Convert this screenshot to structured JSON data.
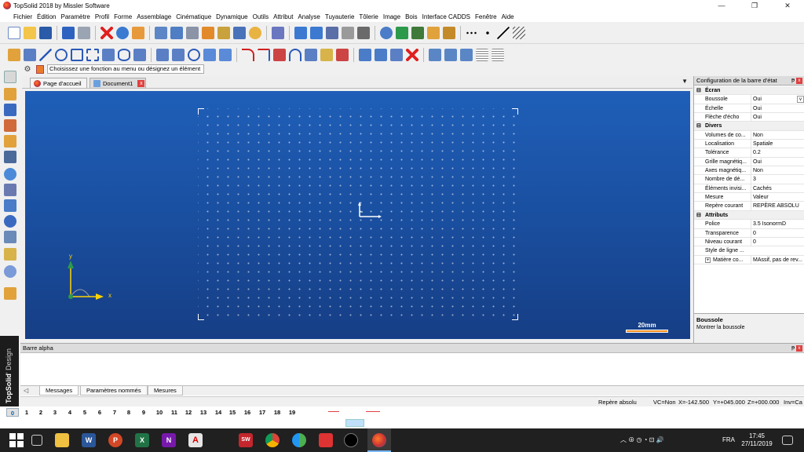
{
  "window": {
    "title": "TopSolid 2018 by Missler Software",
    "minimize_glyph": "—",
    "maximize_glyph": "❐",
    "close_glyph": "✕"
  },
  "menu": [
    "Fichier",
    "Édition",
    "Paramètre",
    "Profil",
    "Forme",
    "Assemblage",
    "Cinématique",
    "Dynamique",
    "Outils",
    "Attribut",
    "Analyse",
    "Tuyauterie",
    "Tôlerie",
    "Image",
    "Bois",
    "Interface CADDS",
    "Fenêtre",
    "Aide"
  ],
  "command_line": {
    "prompt": "Choisissez une fonction au menu ou désignez un élément"
  },
  "document_tabs": [
    {
      "label": "Page d'accueil",
      "active": false
    },
    {
      "label": "Document1",
      "active": true,
      "close_glyph": "x"
    }
  ],
  "tabs_dropdown_glyph": "▼",
  "viewport": {
    "axis_x_label": "x",
    "axis_y_label": "y",
    "scale_label": "20mm",
    "axis_color": "#ffd400",
    "background_top": "#1f5fb8",
    "background_bottom": "#163e85"
  },
  "right_panel": {
    "title": "Configuration de la barre d'état",
    "pin_glyph": "ᵽ",
    "close_glyph": "x",
    "expander_glyph": "⊟",
    "categories": [
      {
        "name": "Écran",
        "rows": [
          {
            "name": "Boussole",
            "value": "Oui",
            "selected": true
          },
          {
            "name": "Échelle",
            "value": "Oui"
          },
          {
            "name": "Flèche d'écho",
            "value": "Oui"
          }
        ]
      },
      {
        "name": "Divers",
        "rows": [
          {
            "name": "Volumes de co...",
            "value": "Non"
          },
          {
            "name": "Localisation",
            "value": "Spatiale"
          },
          {
            "name": "Tolérance",
            "value": "0.2"
          },
          {
            "name": "Grille magnétiq...",
            "value": "Oui"
          },
          {
            "name": "Axes magnétiq...",
            "value": "Non"
          },
          {
            "name": "Nombre de dé...",
            "value": "3"
          },
          {
            "name": "Éléments invisi...",
            "value": "Cachés"
          },
          {
            "name": "Mesure",
            "value": "Valeur"
          },
          {
            "name": "Repère courant",
            "value": "REPÈRE ABSOLU"
          }
        ]
      },
      {
        "name": "Attributs",
        "rows": [
          {
            "name": "Police",
            "value": "3.5  IsonormD"
          },
          {
            "name": "Transparence",
            "value": "0"
          },
          {
            "name": "Niveau courant",
            "value": "0"
          },
          {
            "name": "Style de ligne ...",
            "value": ""
          },
          {
            "name": "Matière co...",
            "value": "MAssif, pas de rev...",
            "plus": true
          }
        ]
      }
    ],
    "combo_glyph": "v",
    "plus_glyph": "+",
    "description_title": "Boussole",
    "description_text": "Montrer la boussole"
  },
  "bottom_pane": {
    "title": "Barre alpha",
    "pin_glyph": "ᵽ",
    "close_glyph": "x",
    "left_glyph": "◁",
    "tabs": [
      "Messages",
      "Paramètres nommés",
      "Mesures"
    ]
  },
  "status_bar": {
    "frame": "Repère absolu",
    "vc": "VC=Non",
    "x": "X=-142.500",
    "y": "Y=+045.000",
    "z": "Z=+000.000",
    "inv": "Inv=Ca"
  },
  "layers": [
    "0",
    "1",
    "2",
    "3",
    "4",
    "5",
    "6",
    "7",
    "8",
    "9",
    "10",
    "11",
    "12",
    "13",
    "14",
    "15",
    "16",
    "17",
    "18",
    "19"
  ],
  "brand": {
    "part1": "TopSolid",
    "part2": "' Design"
  },
  "taskbar": {
    "tray_icons": "︿  ⊕  ◷  ◔  ⊡  🔊",
    "language": "FRA",
    "time": "17:45",
    "date": "27/11/2019",
    "app_labels": {
      "word": "W",
      "powerpoint": "P",
      "excel": "X",
      "onenote": "N",
      "acrobat": "A",
      "solidworks": "SW"
    }
  }
}
